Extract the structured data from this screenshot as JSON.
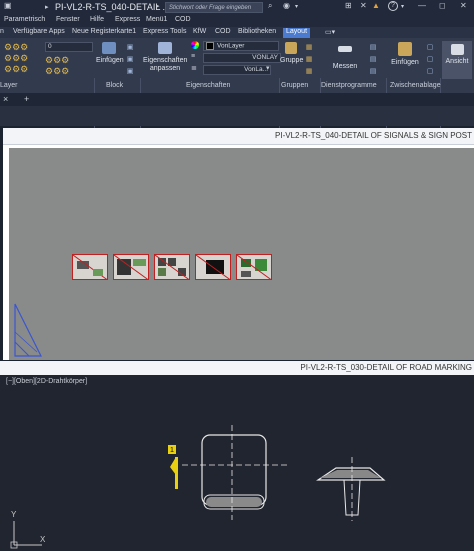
{
  "titlebar": {
    "title": "PI-VL2-R-TS_040-DETAIL ...",
    "search_placeholder": "Stichwort oder Frage eingeben",
    "help": "?"
  },
  "menubar": [
    "Parametrisch",
    "Fenster",
    "Hilfe",
    "Express",
    "Menü1",
    "COD"
  ],
  "tabs": [
    "Verfügbare Apps",
    "Neue Registerkarte1",
    "Express Tools",
    "KfW",
    "COD",
    "Bibliotheken",
    "Layout"
  ],
  "ribbon": {
    "layer_value": "0",
    "btn_insert": "Einfügen",
    "btn_properties": [
      "Eigenschaften",
      "anpassen"
    ],
    "color_value": "VonLayer",
    "linetype_value": "VONLAY",
    "lineweight_value": "VonLa...",
    "btn_group": "Gruppe",
    "btn_measure": "Messen",
    "btn_paste": "Einfügen",
    "btn_view": "Ansicht",
    "panels": [
      "Layer",
      "Block",
      "Eigenschaften",
      "Gruppen",
      "Dienstprogramme",
      "Zwischenablage"
    ]
  },
  "filetabs": {
    "close": "×",
    "add": "+"
  },
  "viewport_top": {
    "title": "PI-VL2-R-TS_040-DETAIL OF SIGNALS & SIGN POST"
  },
  "viewport_bottom": {
    "title": "PI-VL2-R-TS_030-DETAIL OF ROAD MARKING",
    "label": "[−][Oben][2D-Drahtkörper]",
    "axis_x": "X",
    "axis_y": "Y",
    "marker": "1"
  },
  "colors": {
    "accent": "#4a7bd0",
    "canvas_gray": "#898b8b",
    "model_bg": "#21252f"
  }
}
